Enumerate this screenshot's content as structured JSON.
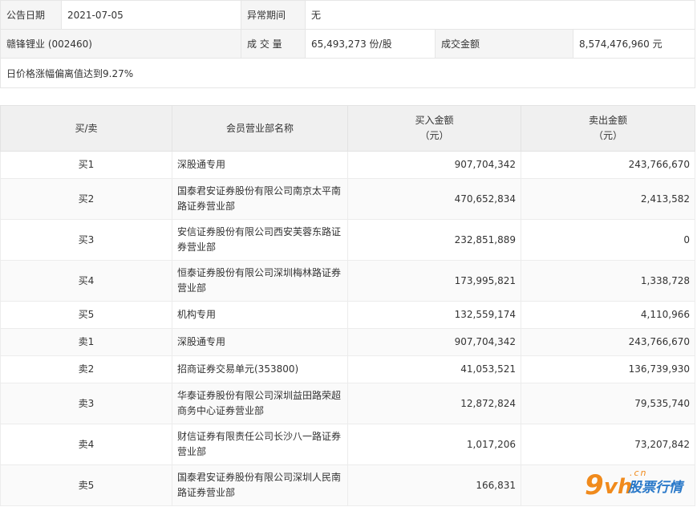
{
  "info": {
    "announce_date_label": "公告日期",
    "announce_date": "2021-07-05",
    "abnormal_period_label": "异常期间",
    "abnormal_period": "无",
    "stock_name": "赣锋锂业 (002460)",
    "volume_label": "成 交 量",
    "volume": "65,493,273 份/股",
    "turnover_label": "成交金额",
    "turnover": "8,574,476,960 元",
    "note": "日价格涨幅偏离值达到9.27%"
  },
  "table": {
    "headers": {
      "side": "买/卖",
      "dept": "会员营业部名称",
      "buy_line1": "买入金额",
      "buy_line2": "（元）",
      "sell_line1": "卖出金额",
      "sell_line2": "（元）"
    },
    "rows": [
      {
        "side": "买1",
        "dept_line1": "深股通专用",
        "dept_line2": "",
        "buy": "907,704,342",
        "sell": "243,766,670"
      },
      {
        "side": "买2",
        "dept_line1": "国泰君安证券股份有限公司南京太平南",
        "dept_line2": "路证券营业部",
        "buy": "470,652,834",
        "sell": "2,413,582"
      },
      {
        "side": "买3",
        "dept_line1": "安信证券股份有限公司西安芙蓉东路证",
        "dept_line2": "券营业部",
        "buy": "232,851,889",
        "sell": "0"
      },
      {
        "side": "买4",
        "dept_line1": "恒泰证券股份有限公司深圳梅林路证券",
        "dept_line2": "营业部",
        "buy": "173,995,821",
        "sell": "1,338,728"
      },
      {
        "side": "买5",
        "dept_line1": "机构专用",
        "dept_line2": "",
        "buy": "132,559,174",
        "sell": "4,110,966"
      },
      {
        "side": "卖1",
        "dept_line1": "深股通专用",
        "dept_line2": "",
        "buy": "907,704,342",
        "sell": "243,766,670"
      },
      {
        "side": "卖2",
        "dept_line1": "招商证券交易单元(353800)",
        "dept_line2": "",
        "buy": "41,053,521",
        "sell": "136,739,930"
      },
      {
        "side": "卖3",
        "dept_line1": "华泰证券股份有限公司深圳益田路荣超",
        "dept_line2": "商务中心证券营业部",
        "buy": "12,872,824",
        "sell": "79,535,740"
      },
      {
        "side": "卖4",
        "dept_line1": "财信证券有限责任公司长沙八一路证券",
        "dept_line2": "营业部",
        "buy": "1,017,206",
        "sell": "73,207,842"
      },
      {
        "side": "卖5",
        "dept_line1": "国泰君安证券股份有限公司深圳人民南",
        "dept_line2": "路证券营业部",
        "buy": "166,831",
        "sell": ""
      }
    ]
  },
  "watermark": {
    "nine": "9",
    "vh": "vh",
    "cn": ".cn",
    "brand": "股票行情"
  },
  "colors": {
    "header_bg": "#f0f0f0",
    "label_bg": "#f5f5f5",
    "border": "#e6e6e6",
    "watermark_orange": "#f08a1c",
    "watermark_blue": "#2a79c9"
  }
}
